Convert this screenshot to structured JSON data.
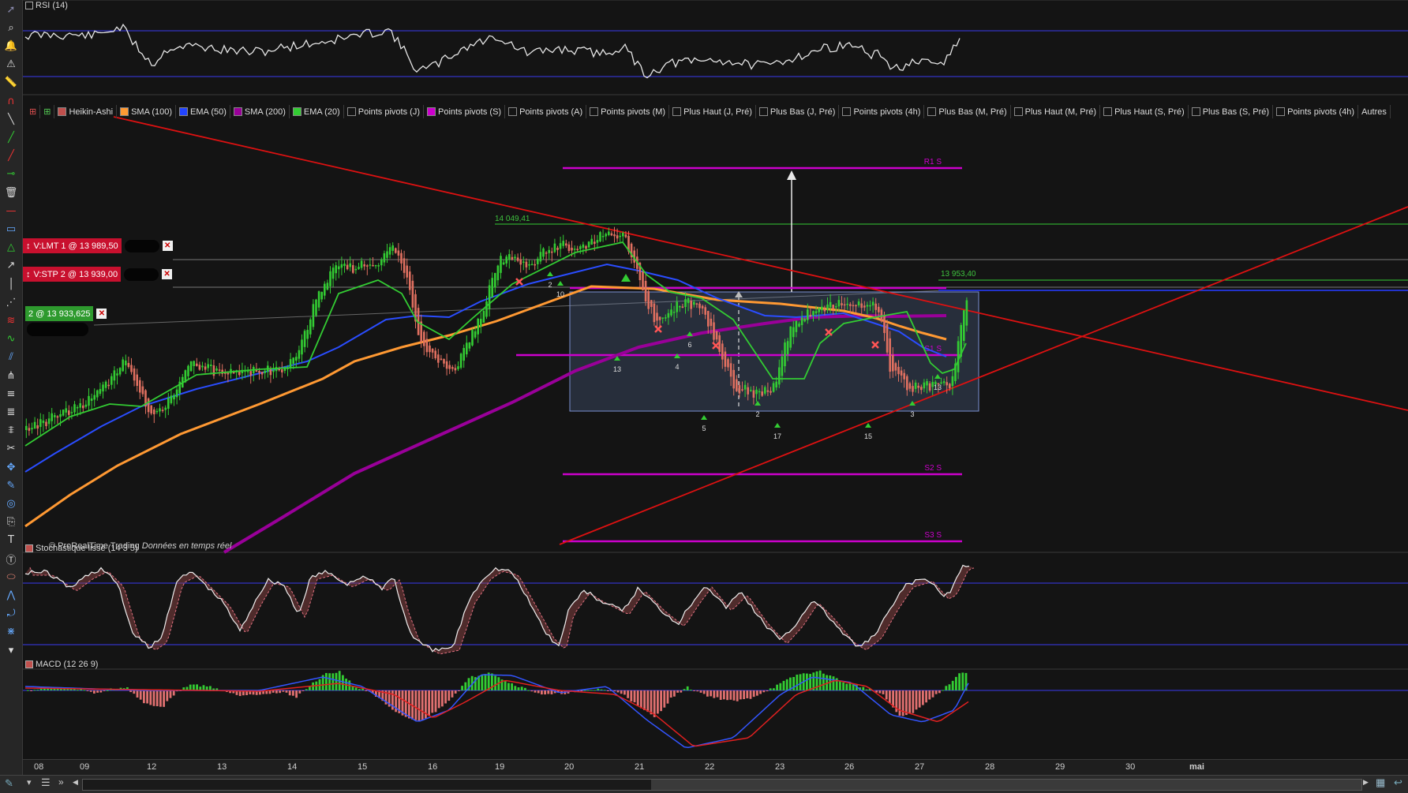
{
  "toolbar": {
    "icons": [
      "cursor-icon",
      "zoom-icon",
      "alert-icon",
      "alerts-list-icon",
      "ruler-icon",
      "magnet-icon",
      "line-icon",
      "trendline-green-icon",
      "trendline-red-icon",
      "horizontal-line-icon",
      "trash-icon",
      "horizontal-red-icon",
      "rectangle-icon",
      "triangle-icon",
      "arrow-icon",
      "vertical-line-icon",
      "polyline-icon",
      "fibonacci-icon",
      "wave-icon",
      "channel-icon",
      "pitchfork-icon",
      "indicator-f-icon",
      "indicator-e-icon",
      "volume-icon",
      "tools-icon",
      "move-icon",
      "pen-icon",
      "target-icon",
      "copy-icon",
      "text-icon",
      "text-circle-icon",
      "ellipse-icon",
      "pattern-icon",
      "lasso-icon",
      "multi-icon",
      "chevron-down-icon"
    ]
  },
  "panes": {
    "rsi": {
      "label": "RSI (14)"
    },
    "stoch": {
      "label": "Stochastique lissé (14 3 5)"
    },
    "macd": {
      "label": "MACD (12 26 9)"
    }
  },
  "legend": {
    "items": [
      {
        "label": "Heikin-Ashi",
        "color": "#c0504d"
      },
      {
        "label": "SMA (100)",
        "color": "#ff9933"
      },
      {
        "label": "EMA (50)",
        "color": "#2244ff"
      },
      {
        "label": "SMA (200)",
        "color": "#990099"
      },
      {
        "label": "EMA (20)",
        "color": "#33cc33"
      },
      {
        "label": "Points pivots (J)",
        "color": ""
      },
      {
        "label": "Points pivots (S)",
        "color": "#cc00cc"
      },
      {
        "label": "Points pivots (A)",
        "color": ""
      },
      {
        "label": "Points pivots (M)",
        "color": ""
      },
      {
        "label": "Plus Haut (J, Pré)",
        "color": ""
      },
      {
        "label": "Plus Bas (J, Pré)",
        "color": ""
      },
      {
        "label": "Points pivots (4h)",
        "color": ""
      },
      {
        "label": "Plus Bas (M, Pré)",
        "color": ""
      },
      {
        "label": "Plus Haut (M, Pré)",
        "color": ""
      },
      {
        "label": "Plus Haut (S, Pré)",
        "color": ""
      },
      {
        "label": "Plus Bas (S, Pré)",
        "color": ""
      },
      {
        "label": "Points pivots (4h)",
        "color": ""
      },
      {
        "label": "Autres",
        "color": ""
      }
    ]
  },
  "orders": {
    "limit": {
      "label": "V:LMT  1 @ 13 989,50"
    },
    "stop": {
      "label": "V:STP  2 @ 13 939,00"
    },
    "position": {
      "label": "2 @ 13 933,625"
    }
  },
  "footer": {
    "brand": "© ProRealTime Trading",
    "realtime": "Données en temps réel"
  },
  "chart_data": {
    "type": "candlestick",
    "style": "Heikin-Ashi",
    "x_ticks": [
      "08",
      "09",
      "12",
      "13",
      "14",
      "15",
      "16",
      "19",
      "20",
      "21",
      "22",
      "23",
      "26",
      "27",
      "28",
      "29",
      "30",
      "mai"
    ],
    "price_levels": [
      {
        "name": "R1 S",
        "value": 14120
      },
      {
        "name": "S1 S",
        "value": 13870
      },
      {
        "name": "S2 S",
        "value": 13720
      },
      {
        "name": "S3 S",
        "value": 13660
      }
    ],
    "annotations": [
      {
        "text": "14 049,41"
      },
      {
        "text": "13 953,40"
      }
    ],
    "counts": [
      "13",
      "10",
      "2",
      "4",
      "6",
      "5",
      "2",
      "17",
      "15",
      "3",
      "13"
    ],
    "indicators": [
      "SMA (100)",
      "EMA (50)",
      "SMA (200)",
      "EMA (20)"
    ],
    "grid": false
  },
  "colors": {
    "background": "#141414",
    "bull_candle": "#33cc33",
    "bear_candle": "#e07060",
    "sma100": "#ff9933",
    "ema50": "#2a4dff",
    "sma200": "#990099",
    "ema20": "#33cc33",
    "pivot": "#cc00cc",
    "trendline": "#dd1111",
    "green_level": "#33cc33"
  }
}
